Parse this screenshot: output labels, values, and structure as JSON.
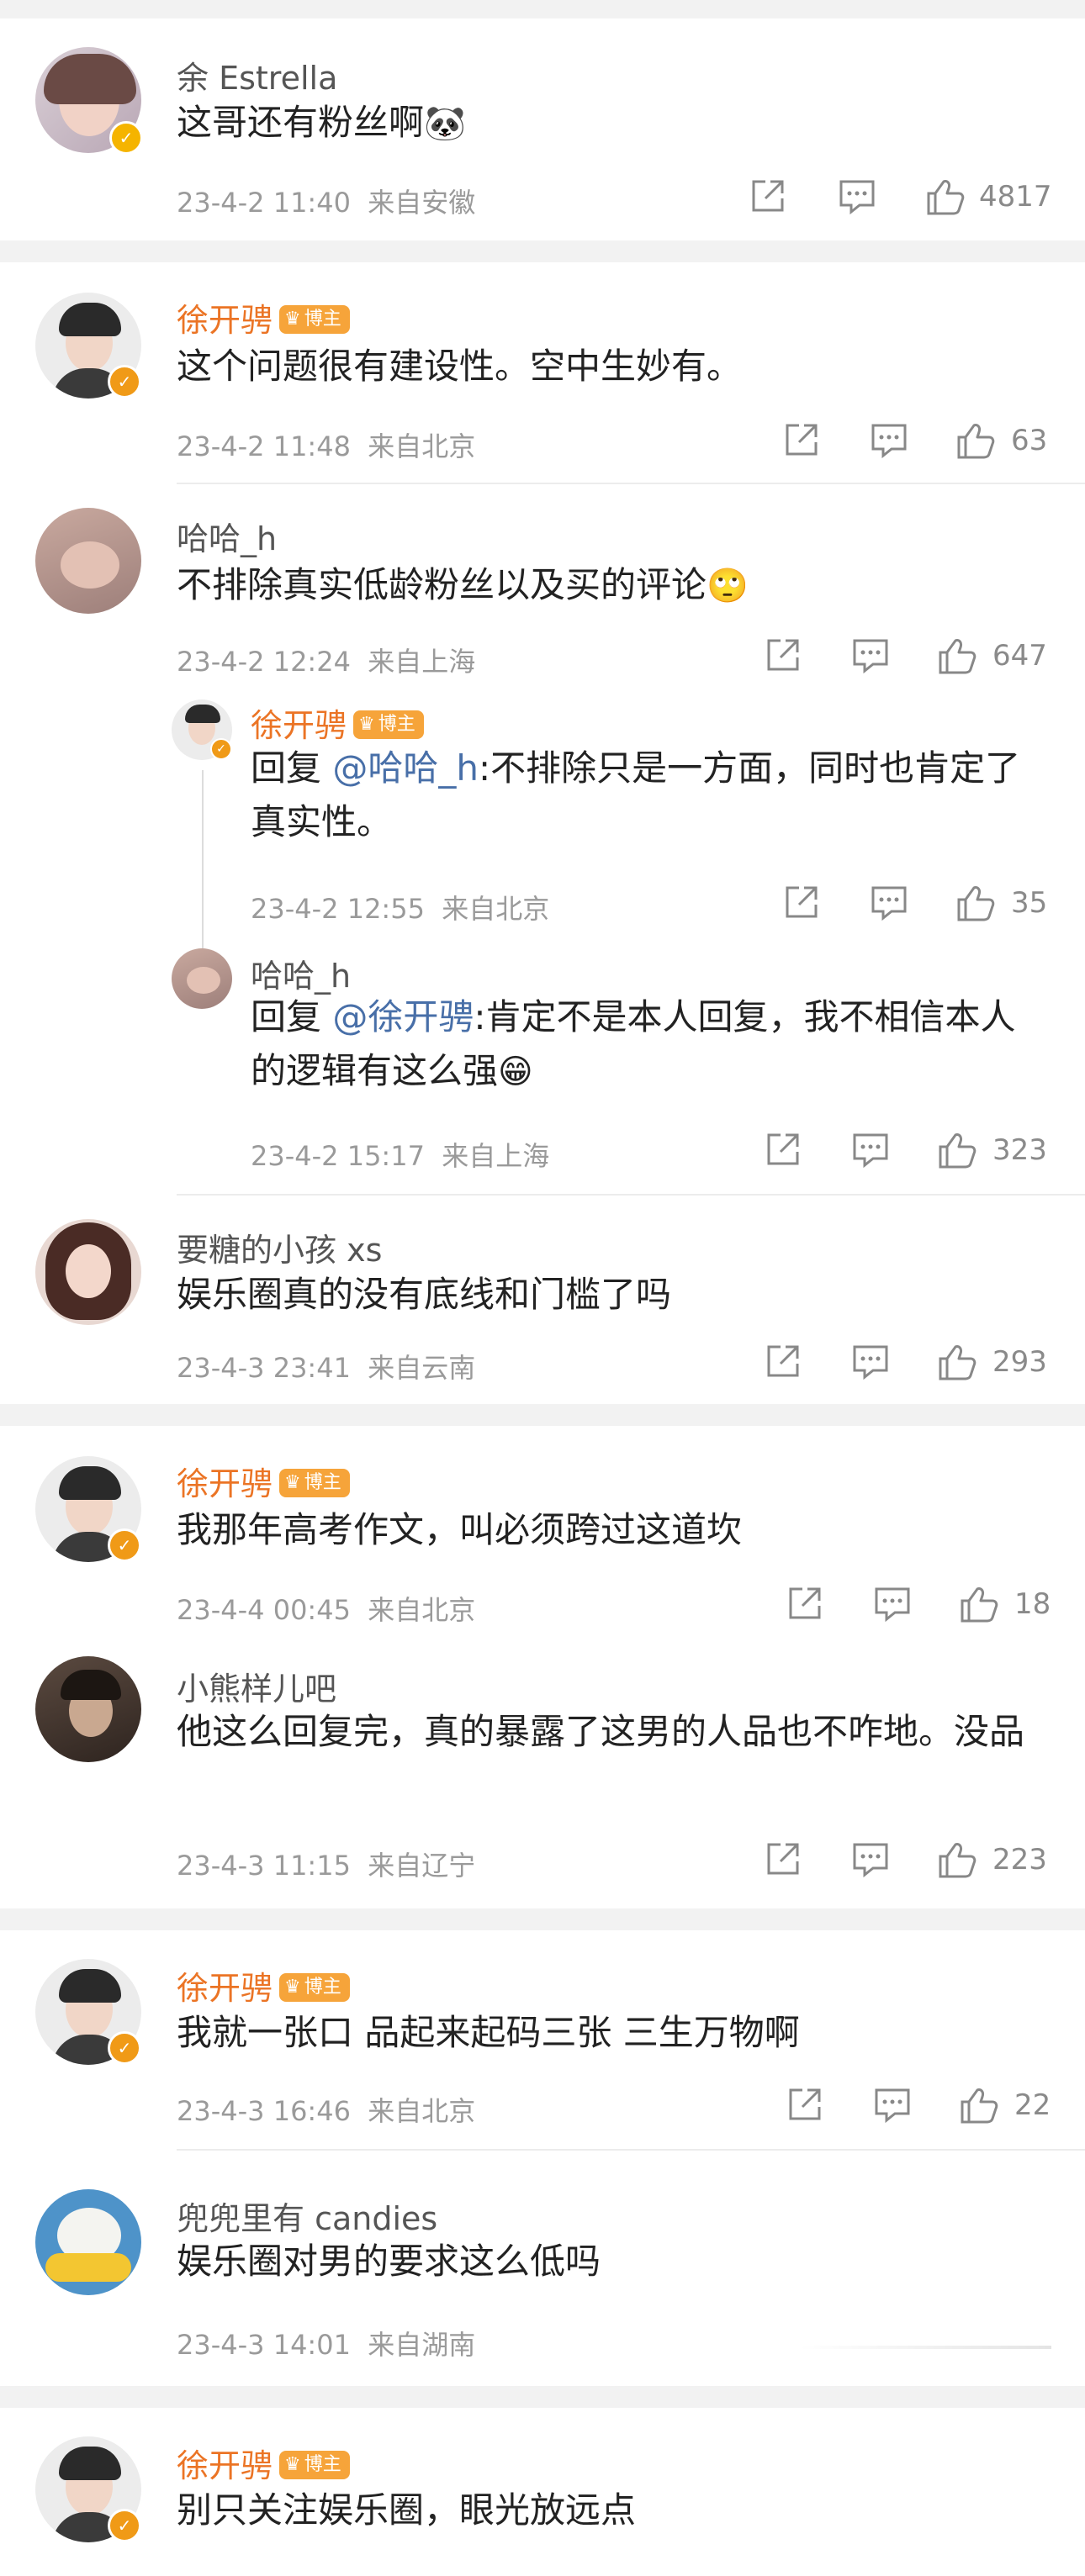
{
  "comments": [
    {
      "name": "余 Estrella",
      "blogger": false,
      "text": "这哥还有粉丝啊",
      "emoji": "🐼",
      "date": "23-4-2 11:40",
      "location": "来自安徽",
      "likes": "4817"
    },
    {
      "name": "徐开骋",
      "blogger": true,
      "tag": "博主",
      "text": "这个问题很有建设性。空中生妙有。",
      "date": "23-4-2 11:48",
      "location": "来自北京",
      "likes": "63"
    },
    {
      "name": "哈哈_h",
      "blogger": false,
      "text": "不排除真实低龄粉丝以及买的评论",
      "emoji": "🙄",
      "date": "23-4-2 12:24",
      "location": "来自上海",
      "likes": "647"
    },
    {
      "name": "徐开骋",
      "blogger": true,
      "tag": "博主",
      "reply_prefix": "回复 ",
      "mention": "@哈哈_h",
      "text": ":不排除只是一方面，同时也肯定了真实性。",
      "date": "23-4-2 12:55",
      "location": "来自北京",
      "likes": "35"
    },
    {
      "name": "哈哈_h",
      "blogger": false,
      "reply_prefix": "回复 ",
      "mention": "@徐开骋",
      "text": ":肯定不是本人回复，我不相信本人的逻辑有这么强",
      "emoji": "😁",
      "date": "23-4-2 15:17",
      "location": "来自上海",
      "likes": "323"
    },
    {
      "name": "要糖的小孩 xs",
      "blogger": false,
      "text": "娱乐圈真的没有底线和门槛了吗",
      "date": "23-4-3 23:41",
      "location": "来自云南",
      "likes": "293"
    },
    {
      "name": "徐开骋",
      "blogger": true,
      "tag": "博主",
      "text": "我那年高考作文，叫必须跨过这道坎",
      "date": "23-4-4 00:45",
      "location": "来自北京",
      "likes": "18"
    },
    {
      "name": "小熊样儿吧",
      "blogger": false,
      "text": "他这么回复完，真的暴露了这男的人品也不咋地。没品",
      "date": "23-4-3 11:15",
      "location": "来自辽宁",
      "likes": "223"
    },
    {
      "name": "徐开骋",
      "blogger": true,
      "tag": "博主",
      "text": "我就一张口 品起来起码三张 三生万物啊",
      "date": "23-4-3 16:46",
      "location": "来自北京",
      "likes": "22"
    },
    {
      "name": "兜兜里有 candies",
      "blogger": false,
      "text": "娱乐圈对男的要求这么低吗",
      "date": "23-4-3 14:01",
      "location": "来自湖南",
      "likes": ""
    },
    {
      "name": "徐开骋",
      "blogger": true,
      "tag": "博主",
      "text": "别只关注娱乐圈，眼光放远点",
      "date": "",
      "location": "",
      "likes": ""
    }
  ],
  "colors": {
    "blogger_name": "#eb7425",
    "tag_bg": "#f6a43a",
    "mention": "#486fa8",
    "meta": "#9a9a9a",
    "divider": "#f2f2f2"
  },
  "icons": {
    "share": "share-icon",
    "comment": "comment-icon",
    "like": "thumbs-up-icon",
    "verified": "verified-badge-icon",
    "crown": "crown-icon"
  }
}
